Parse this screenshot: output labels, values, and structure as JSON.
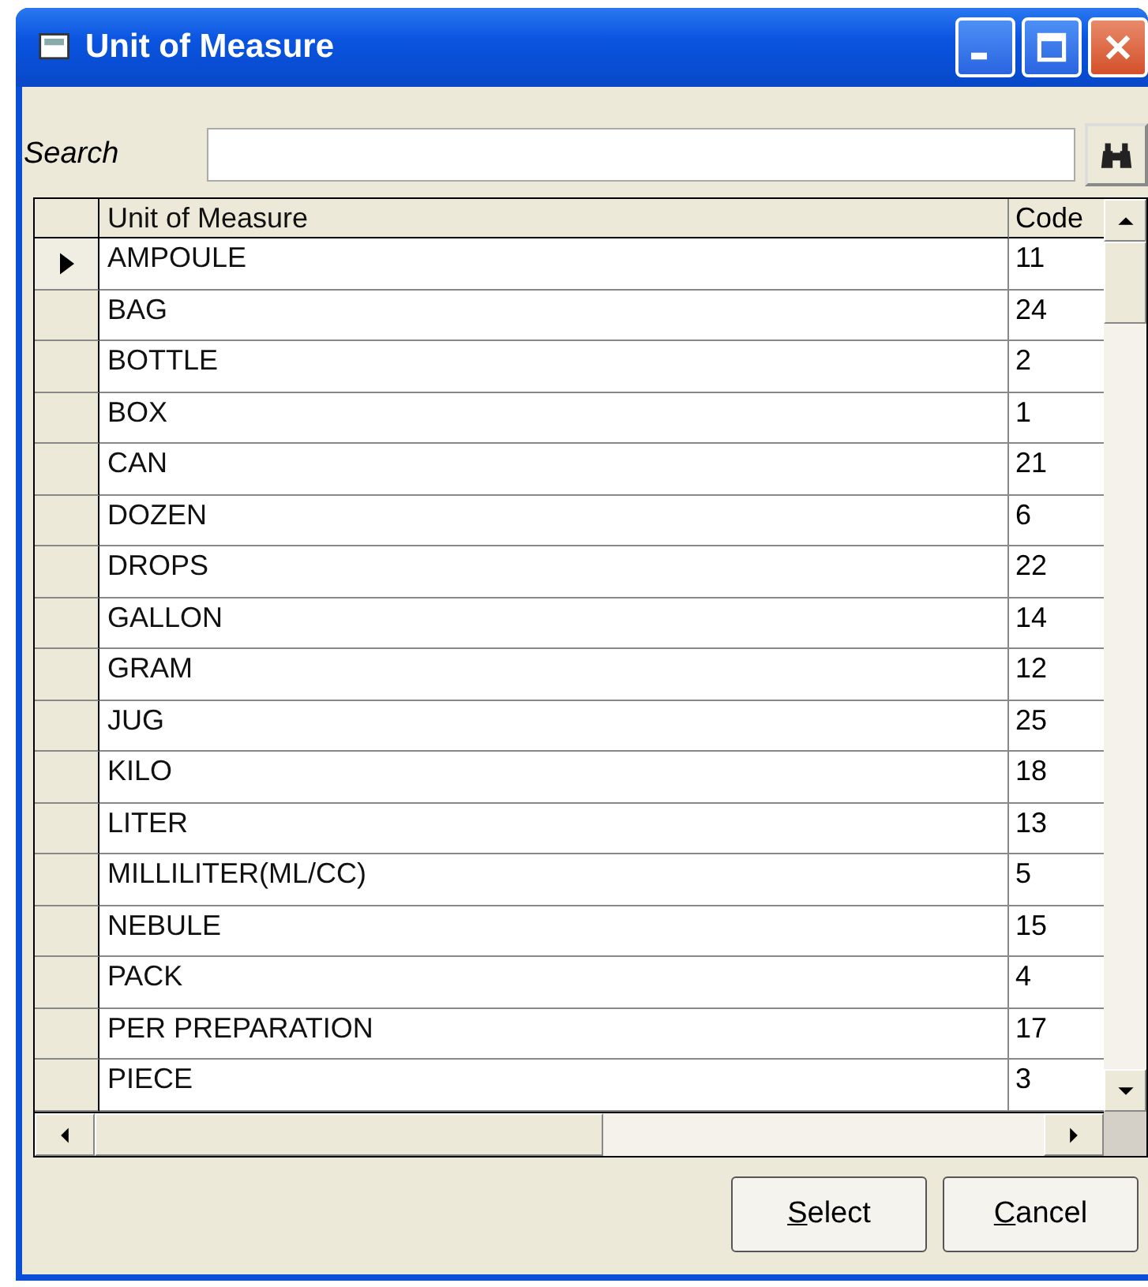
{
  "window": {
    "title": "Unit of Measure"
  },
  "search": {
    "label": "Search"
  },
  "table": {
    "columns": [
      "Unit of Measure",
      "Code"
    ],
    "rows": [
      {
        "name": "AMPOULE",
        "code": "11",
        "current": true
      },
      {
        "name": "BAG",
        "code": "24",
        "current": false
      },
      {
        "name": "BOTTLE",
        "code": "2",
        "current": false
      },
      {
        "name": "BOX",
        "code": "1",
        "current": false
      },
      {
        "name": "CAN",
        "code": "21",
        "current": false
      },
      {
        "name": "DOZEN",
        "code": "6",
        "current": false
      },
      {
        "name": "DROPS",
        "code": "22",
        "current": false
      },
      {
        "name": "GALLON",
        "code": "14",
        "current": false
      },
      {
        "name": "GRAM",
        "code": "12",
        "current": false
      },
      {
        "name": "JUG",
        "code": "25",
        "current": false
      },
      {
        "name": "KILO",
        "code": "18",
        "current": false
      },
      {
        "name": "LITER",
        "code": "13",
        "current": false
      },
      {
        "name": "MILLILITER(ML/CC)",
        "code": "5",
        "current": false
      },
      {
        "name": "NEBULE",
        "code": "15",
        "current": false
      },
      {
        "name": "PACK",
        "code": "4",
        "current": false
      },
      {
        "name": "PER PREPARATION",
        "code": "17",
        "current": false
      },
      {
        "name": "PIECE",
        "code": "3",
        "current": false
      }
    ]
  },
  "buttons": [
    {
      "label": "Select"
    },
    {
      "label": "Cancel"
    }
  ]
}
